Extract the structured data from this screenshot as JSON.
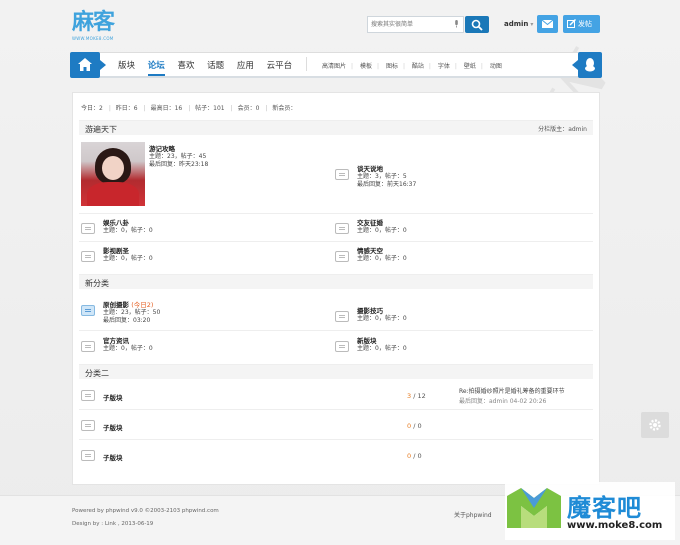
{
  "header": {
    "logo_text": "麻客",
    "logo_sub": "WWW.MOKE8.COM",
    "search_placeholder": "搜索其实很简单",
    "username": "admin",
    "user_caret": "▾",
    "post_label": "发帖"
  },
  "nav": {
    "main": [
      "版块",
      "论坛",
      "喜欢",
      "话题",
      "应用",
      "云平台"
    ],
    "active_index": 1,
    "sub": [
      "高清图片",
      "模板",
      "图标",
      "酷站",
      "字体",
      "壁纸",
      "动图"
    ]
  },
  "stats": {
    "today": "今日：2",
    "yesterday": "昨日：6",
    "max": "最高日：16",
    "posts": "帖子：101",
    "members": "会员：0",
    "new_member": "新会员："
  },
  "categories": [
    {
      "title": "游遍天下",
      "moderator_label": "分栏版主：",
      "moderator": "admin",
      "forums": [
        {
          "name": "游记攻略",
          "stat": "主题：23，帖子：45",
          "last": "最后回复：昨天23:18"
        },
        {
          "name": "谈天说地",
          "stat": "主题：3，帖子：5",
          "last": "最后回复：前天16:37"
        },
        {
          "name": "娱乐八卦",
          "stat": "主题：0，帖子：0"
        },
        {
          "name": "交友征婚",
          "stat": "主题：0，帖子：0"
        },
        {
          "name": "影视剧圣",
          "stat": "主题：0，帖子：0"
        },
        {
          "name": "情感天空",
          "stat": "主题：0，帖子：0"
        }
      ]
    },
    {
      "title": "新分类",
      "forums": [
        {
          "name": "原创摄影",
          "today": "(今日2)",
          "stat": "主题：23，帖子：50",
          "last": "最后回复：03:20"
        },
        {
          "name": "摄影技巧",
          "stat": "主题：0，帖子：0"
        },
        {
          "name": "官方资讯",
          "stat": "主题：0，帖子：0"
        },
        {
          "name": "新版块",
          "stat": "主题：0，帖子：0"
        }
      ]
    },
    {
      "title": "分类二",
      "rows": [
        {
          "name": "子版块",
          "topics": "3",
          "posts": "12",
          "last_title": "Re:拍摄婚纱照片是婚礼筹备的重要环节",
          "last_info": "最后回复：admin 04-02 20:26"
        },
        {
          "name": "子版块",
          "topics": "0",
          "posts": "0"
        },
        {
          "name": "子版块",
          "topics": "0",
          "posts": "0"
        }
      ]
    }
  ],
  "footer": {
    "powered": "Powered by phpwind v9.0 ©2003-2103 phpwind.com",
    "design": "Design by : Link , 2013-06-19",
    "about": "关于phpwind"
  },
  "brand": {
    "name": "魔客吧",
    "url": "www.moke8.com"
  }
}
